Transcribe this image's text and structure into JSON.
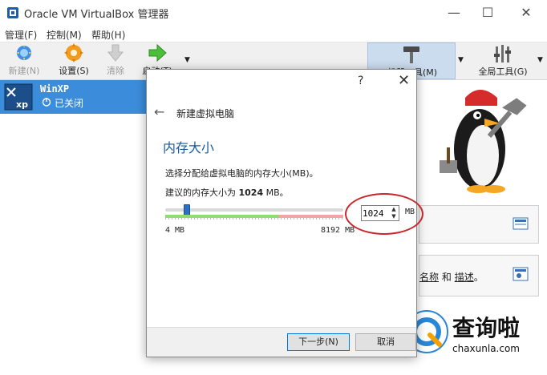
{
  "window": {
    "title": "Oracle VM VirtualBox 管理器",
    "controls": {
      "minimize": "—",
      "maximize": "☐",
      "close": "✕"
    }
  },
  "menubar": {
    "items": [
      "管理(F)",
      "控制(M)",
      "帮助(H)"
    ]
  },
  "toolbar": {
    "new_label": "新建(N)",
    "settings_label": "设置(S)",
    "discard_label": "清除",
    "start_label": "启动(T)",
    "machine_tools_label": "机器工具(M)",
    "global_tools_label": "全局工具(G)"
  },
  "vm_list": {
    "items": [
      {
        "name": "WinXP",
        "state": "已关闭",
        "os": "xp"
      }
    ]
  },
  "right_panel": {
    "box2_text_connector": "和",
    "box2_link1": "名称",
    "box2_link2": "描述",
    "box2_suffix": "。"
  },
  "dialog": {
    "help": "?",
    "close": "✕",
    "back": "←",
    "title": "新建虚拟电脑",
    "page_title": "内存大小",
    "description": "选择分配给虚拟电脑的内存大小(MB)。",
    "recommend_prefix": "建议的内存大小为",
    "recommend_value": "1024",
    "recommend_suffix": "MB。",
    "memory": {
      "value": "1024",
      "unit": "MB",
      "min_label": "4 MB",
      "max_label": "8192 MB",
      "min": 4,
      "max": 8192,
      "current": 1024
    },
    "next_button": "下一步(N)",
    "cancel_button": "取消"
  },
  "watermark": {
    "cn": "查询啦",
    "en": "chaxunla.com"
  },
  "colors": {
    "accent": "#3b8ddb",
    "selection": "#3b8ddb",
    "heading": "#1a5a99",
    "annotation": "#c8282d",
    "scale_green": "#8fdc6f",
    "scale_red": "#f2a3a3"
  }
}
